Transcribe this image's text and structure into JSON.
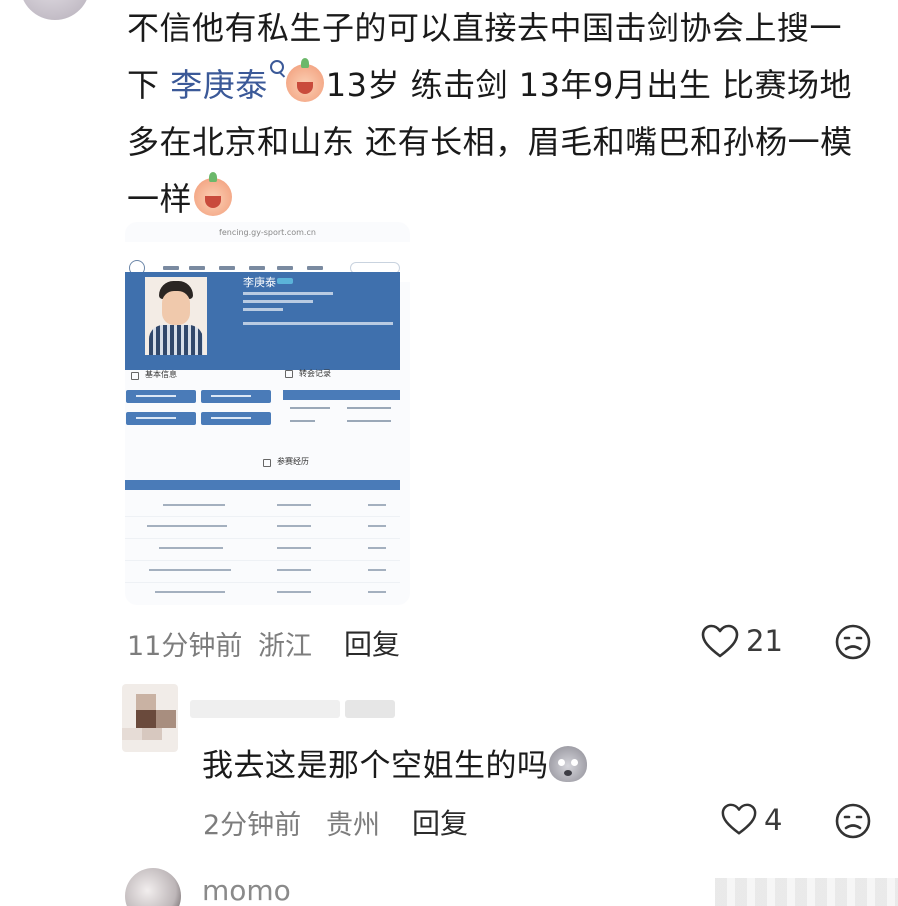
{
  "comment": {
    "line1": "不信他有私生子的可以直接去中国击剑协会上搜一",
    "line2_prefix": "下 ",
    "mention": "李庚泰",
    "line2_suffix": "13岁 练击剑 13年9月出生 比赛场地",
    "line3": "多在北京和山东 还有长相，眉毛和嘴巴和孙杨一模",
    "line4": "一样",
    "emoji": "crying-peach-emoji"
  },
  "screenshot": {
    "url": "fencing.gy-sport.com.cn",
    "athlete_name": "李庚泰",
    "section_basic": "基本信息",
    "section_record": "转会记录",
    "section_history": "参赛经历"
  },
  "comment_meta": {
    "time": "11分钟前",
    "location": "浙江",
    "reply_label": "回复",
    "like_count": "21",
    "like_icon": "heart-outline-icon",
    "dislike_icon": "sad-face-icon"
  },
  "reply": {
    "text": "我去这是那个空姐生的吗",
    "emoji": "shocked-face-emoji",
    "time": "2分钟前",
    "location": "贵州",
    "reply_label": "回复",
    "like_count": "4"
  },
  "next_comment": {
    "username": "momo"
  },
  "colors": {
    "mention": "#3b5998",
    "meta_text": "#7d7d7d",
    "hero_blue": "#3f70ad"
  }
}
